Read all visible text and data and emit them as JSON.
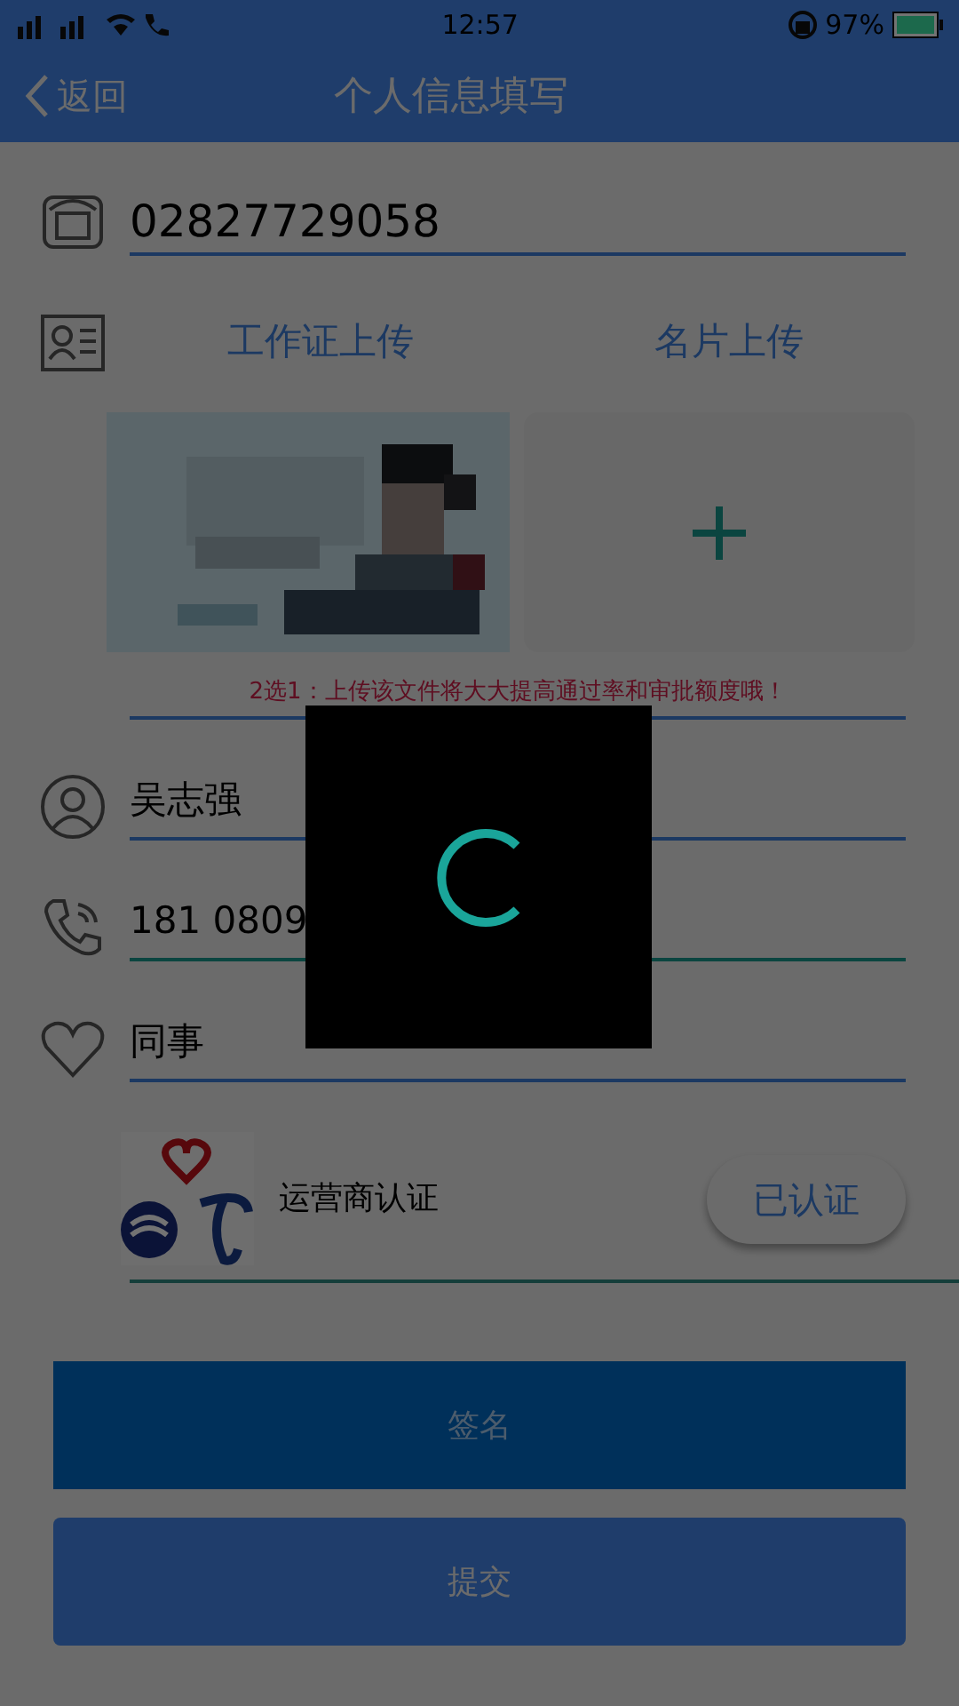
{
  "status_bar": {
    "time": "12:57",
    "battery": "97%"
  },
  "header": {
    "back": "返回",
    "title": "个人信息填写"
  },
  "phone_field": {
    "value": "02827729058",
    "focused": false
  },
  "uploads": [
    {
      "label": "工作证上传",
      "filled": true
    },
    {
      "label": "名片上传",
      "filled": false
    }
  ],
  "hint": "2选1：上传该文件将大大提高通过率和审批额度哦！",
  "fields": [
    {
      "kind": "person",
      "value": "吴志强",
      "focused": false
    },
    {
      "kind": "phone",
      "value": "181 0809",
      "focused": true
    },
    {
      "kind": "relation",
      "value": "同事",
      "focused": false
    }
  ],
  "carrier": {
    "label": "运营商认证",
    "button": "已认证"
  },
  "buttons": [
    {
      "label": "签名",
      "kind": "secondary"
    },
    {
      "label": "提交",
      "kind": "primary"
    }
  ]
}
